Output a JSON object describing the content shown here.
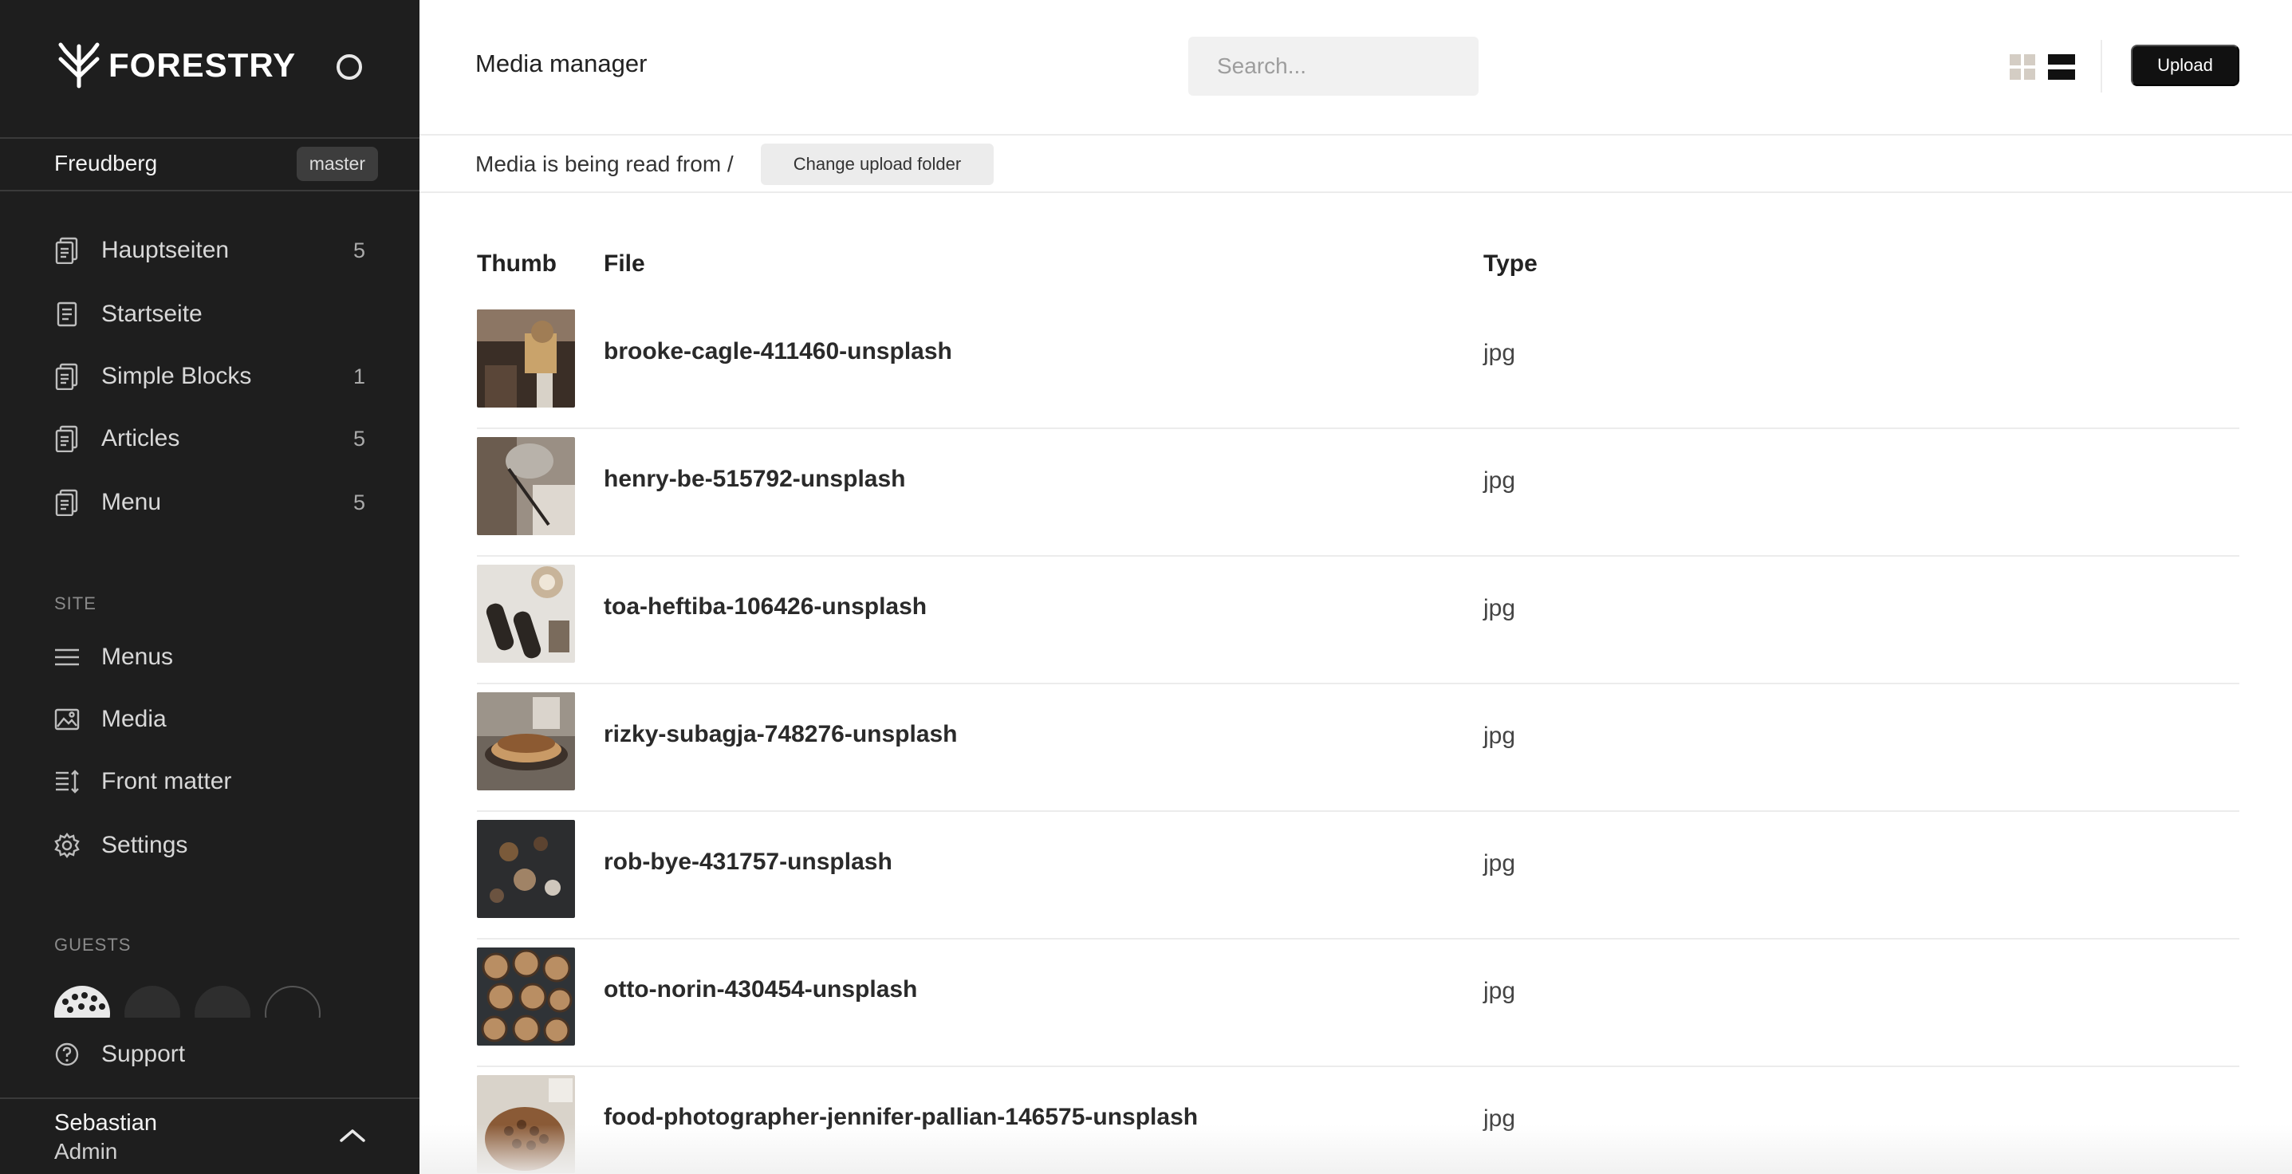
{
  "brand": {
    "name": "FORESTRY"
  },
  "site": {
    "name": "Freudberg",
    "branch": "master"
  },
  "nav": {
    "content_items": [
      {
        "label": "Hauptseiten",
        "count": "5",
        "icon": "documents-icon"
      },
      {
        "label": "Startseite",
        "count": "",
        "icon": "document-icon"
      },
      {
        "label": "Simple Blocks",
        "count": "1",
        "icon": "documents-icon"
      },
      {
        "label": "Articles",
        "count": "5",
        "icon": "documents-icon"
      },
      {
        "label": "Menu",
        "count": "5",
        "icon": "documents-icon"
      }
    ],
    "site_section_label": "SITE",
    "site_items": [
      {
        "label": "Menus",
        "icon": "hamburger-menu-icon"
      },
      {
        "label": "Media",
        "icon": "image-icon"
      },
      {
        "label": "Front matter",
        "icon": "front-matter-icon"
      },
      {
        "label": "Settings",
        "icon": "gear-icon"
      }
    ],
    "guests_section_label": "GUESTS",
    "support_label": "Support"
  },
  "user": {
    "name": "Sebastian",
    "role": "Admin"
  },
  "header": {
    "title": "Media manager",
    "search_placeholder": "Search...",
    "upload_label": "Upload"
  },
  "folder": {
    "text": "Media is being read from /",
    "change_label": "Change upload folder"
  },
  "table": {
    "columns": [
      "Thumb",
      "File",
      "Type"
    ],
    "rows": [
      {
        "file": "brooke-cagle-411460-unsplash",
        "type": "jpg"
      },
      {
        "file": "henry-be-515792-unsplash",
        "type": "jpg"
      },
      {
        "file": "toa-heftiba-106426-unsplash",
        "type": "jpg"
      },
      {
        "file": "rizky-subagja-748276-unsplash",
        "type": "jpg"
      },
      {
        "file": "rob-bye-431757-unsplash",
        "type": "jpg"
      },
      {
        "file": "otto-norin-430454-unsplash",
        "type": "jpg"
      },
      {
        "file": "food-photographer-jennifer-pallian-146575-unsplash",
        "type": "jpg"
      }
    ]
  },
  "colors": {
    "sidebar_bg": "#1e1e1e",
    "upload_bg": "#111111",
    "divider": "#ececec"
  }
}
